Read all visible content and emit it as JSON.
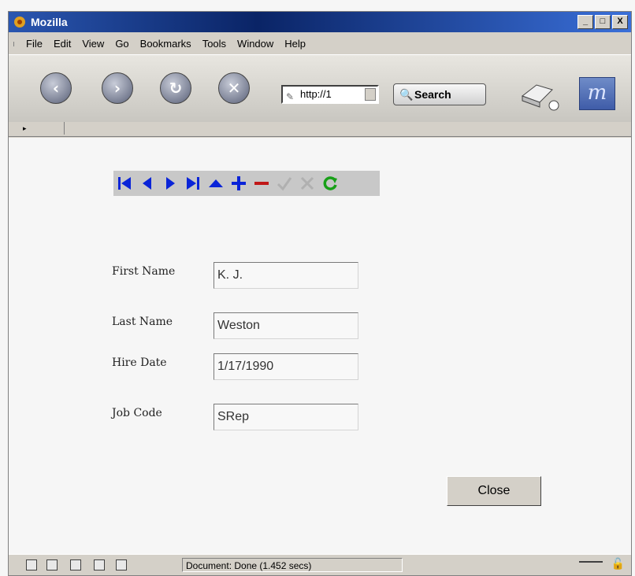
{
  "window": {
    "title": "Mozilla",
    "controls": [
      "_",
      "□",
      "X"
    ]
  },
  "menu": [
    {
      "label": "File"
    },
    {
      "label": "Edit"
    },
    {
      "label": "View"
    },
    {
      "label": "Go"
    },
    {
      "label": "Bookmarks"
    },
    {
      "label": "Tools"
    },
    {
      "label": "Window"
    },
    {
      "label": "Help"
    }
  ],
  "nav": {
    "url": "http://1",
    "search_label": "Search",
    "icons": [
      "back-icon",
      "forward-icon",
      "reload-icon",
      "stop-icon",
      "print-icon",
      "mozilla-logo-icon"
    ]
  },
  "form": {
    "toolbar": [
      "first-record-icon",
      "prior-record-icon",
      "next-record-icon",
      "last-record-icon",
      "insert-icon",
      "append-icon",
      "delete-icon",
      "post-icon",
      "cancel-icon",
      "refresh-icon"
    ],
    "first_name_label": "First Name",
    "first_name_value": "K. J.",
    "last_name_label": "Last Name",
    "last_name_value": "Weston",
    "hire_date_label": "Hire Date",
    "hire_date_value": "1/17/1990",
    "job_code_label": "Job Code",
    "job_code_value": "SRep",
    "close_label": "Close"
  },
  "status": {
    "text": "Document: Done (1.452 secs)"
  },
  "colors": {
    "accent": "#0a24d8",
    "delete": "#c01818",
    "refresh": "#18a018"
  }
}
